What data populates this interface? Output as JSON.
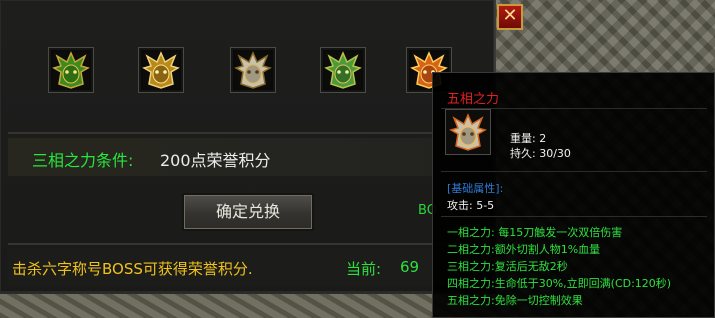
{
  "window": {
    "close_label": "✕"
  },
  "masks": [
    {
      "icon": "green-gold-mask-icon",
      "color": "#3d8a1f"
    },
    {
      "icon": "gold-mask-icon",
      "color": "#b88a1a"
    },
    {
      "icon": "silver-mask-icon",
      "color": "#c9c2a8"
    },
    {
      "icon": "jade-mask-icon",
      "color": "#4d9a3a"
    },
    {
      "icon": "fire-mask-icon",
      "color": "#d5641a"
    }
  ],
  "condition": {
    "label": "三相之力条件:",
    "value": "200点荣誉积分"
  },
  "exchange_button": "确定兑换",
  "partial_text": "BO",
  "footer": {
    "hint": "击杀六字称号BOSS可获得荣誉积分.",
    "current_label": "当前:",
    "current_value": "69"
  },
  "tooltip": {
    "title": "五相之力",
    "weight": "重量: 2",
    "durability": "持久: 30/30",
    "section": "[基础属性]:",
    "attack": "攻击: 5-5",
    "effects": [
      "一相之力: 每15刀触发一次双倍伤害",
      "二相之力:额外切割人物1%血量",
      "三相之力:复活后无敌2秒",
      "四相之力:生命低于30%,立即回满(CD:120秒)",
      "五相之力:免除一切控制效果"
    ]
  }
}
